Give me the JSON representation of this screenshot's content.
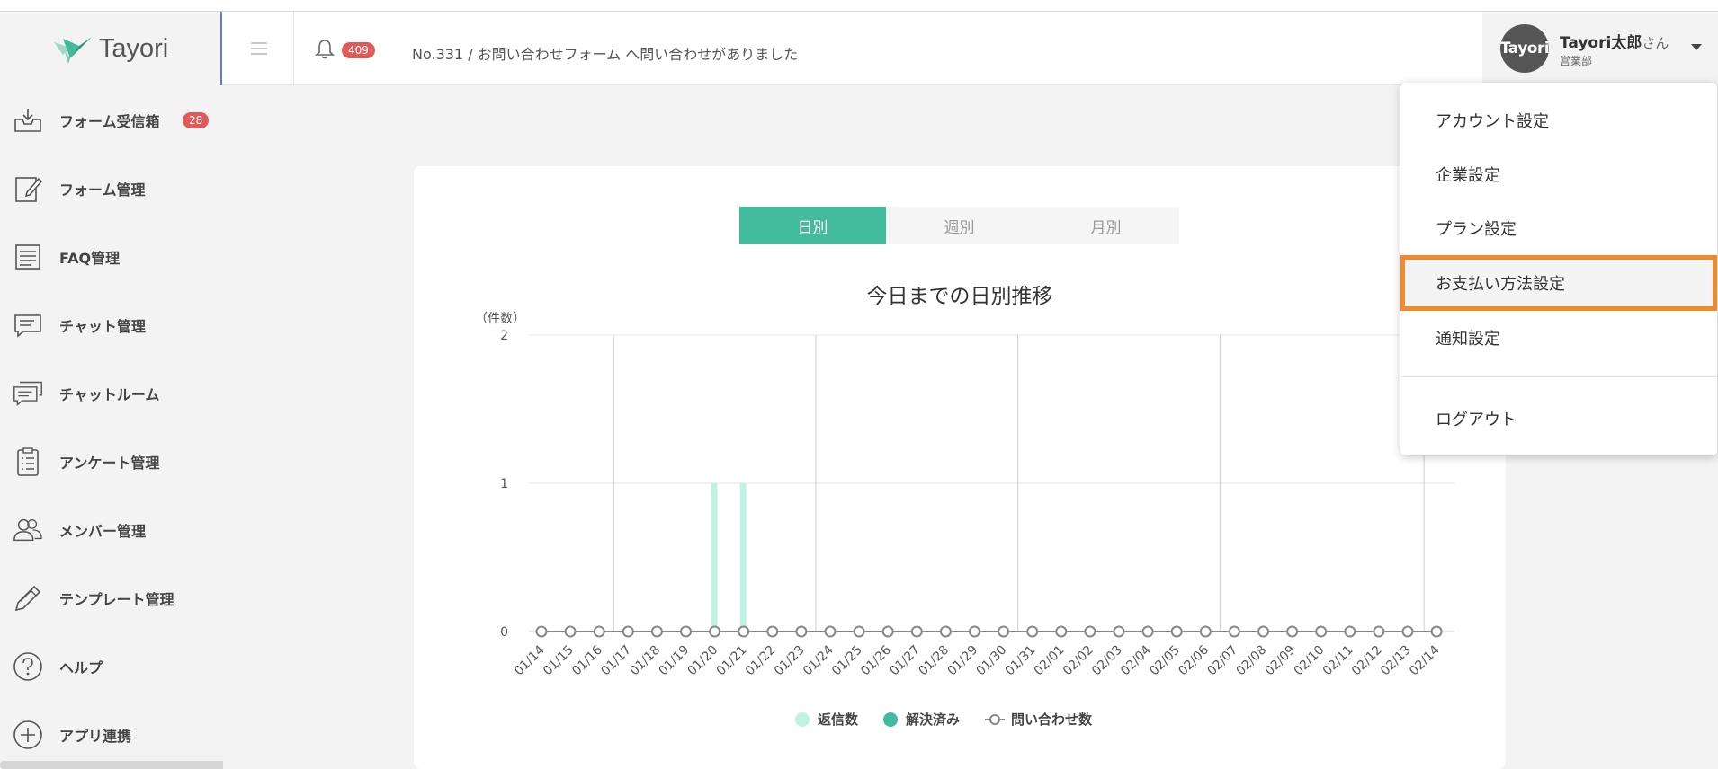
{
  "app": {
    "logo_text": "Tayori"
  },
  "header": {
    "notification_count": "409",
    "notice": "No.331 / お問い合わせフォーム へ問い合わせがありました",
    "user": {
      "avatar_text": "Tayori",
      "name": "Tayori太郎",
      "suffix": "さん",
      "department": "営業部"
    }
  },
  "sidebar": {
    "items": [
      {
        "label": "フォーム受信箱",
        "icon": "inbox-icon",
        "badge": "28"
      },
      {
        "label": "フォーム管理",
        "icon": "edit-form-icon"
      },
      {
        "label": "FAQ管理",
        "icon": "faq-list-icon"
      },
      {
        "label": "チャット管理",
        "icon": "chat-icon"
      },
      {
        "label": "チャットルーム",
        "icon": "chatroom-icon"
      },
      {
        "label": "アンケート管理",
        "icon": "clipboard-icon"
      },
      {
        "label": "メンバー管理",
        "icon": "members-icon"
      },
      {
        "label": "テンプレート管理",
        "icon": "pencil-icon"
      },
      {
        "label": "ヘルプ",
        "icon": "help-icon"
      },
      {
        "label": "アプリ連携",
        "icon": "plus-circle-icon"
      }
    ]
  },
  "tabs": [
    {
      "label": "日別",
      "active": true
    },
    {
      "label": "週別",
      "active": false
    },
    {
      "label": "月別",
      "active": false
    }
  ],
  "menu": {
    "items": [
      {
        "label": "アカウント設定"
      },
      {
        "label": "企業設定"
      },
      {
        "label": "プラン設定"
      },
      {
        "label": "お支払い方法設定",
        "highlighted": true
      },
      {
        "label": "通知設定"
      },
      {
        "label": "ログアウト"
      }
    ]
  },
  "colors": {
    "accent": "#41bb9b",
    "reply": "#bff2e3",
    "resolved": "#41bb9b",
    "highlight_border": "#f38a2a",
    "badge": "#e05a5a"
  },
  "chart_data": {
    "type": "bar",
    "title": "今日までの日別推移",
    "ylabel": "（件数）",
    "ylim": [
      0,
      2
    ],
    "yticks": [
      "0",
      "1",
      "2"
    ],
    "categories": [
      "01/14",
      "01/15",
      "01/16",
      "01/17",
      "01/18",
      "01/19",
      "01/20",
      "01/21",
      "01/22",
      "01/23",
      "01/24",
      "01/25",
      "01/26",
      "01/27",
      "01/28",
      "01/29",
      "01/30",
      "01/31",
      "02/01",
      "02/02",
      "02/03",
      "02/04",
      "02/05",
      "02/06",
      "02/07",
      "02/08",
      "02/09",
      "02/10",
      "02/11",
      "02/12",
      "02/13",
      "02/14"
    ],
    "series": [
      {
        "name": "返信数",
        "kind": "bar",
        "values": [
          0,
          0,
          0,
          0,
          0,
          0,
          1,
          1,
          0,
          0,
          0,
          0,
          0,
          0,
          0,
          0,
          0,
          0,
          0,
          0,
          0,
          0,
          0,
          0,
          0,
          0,
          0,
          0,
          0,
          0,
          0,
          0
        ]
      },
      {
        "name": "解決済み",
        "kind": "bar",
        "values": [
          0,
          0,
          0,
          0,
          0,
          0,
          0,
          0,
          0,
          0,
          0,
          0,
          0,
          0,
          0,
          0,
          0,
          0,
          0,
          0,
          0,
          0,
          0,
          0,
          0,
          0,
          0,
          0,
          0,
          0,
          0,
          0
        ]
      },
      {
        "name": "問い合わせ数",
        "kind": "line",
        "values": [
          0,
          0,
          0,
          0,
          0,
          0,
          0,
          0,
          0,
          0,
          0,
          0,
          0,
          0,
          0,
          0,
          0,
          0,
          0,
          0,
          0,
          0,
          0,
          0,
          0,
          0,
          0,
          0,
          0,
          0,
          0,
          0
        ]
      }
    ],
    "grid": true,
    "legend": "bottom"
  }
}
